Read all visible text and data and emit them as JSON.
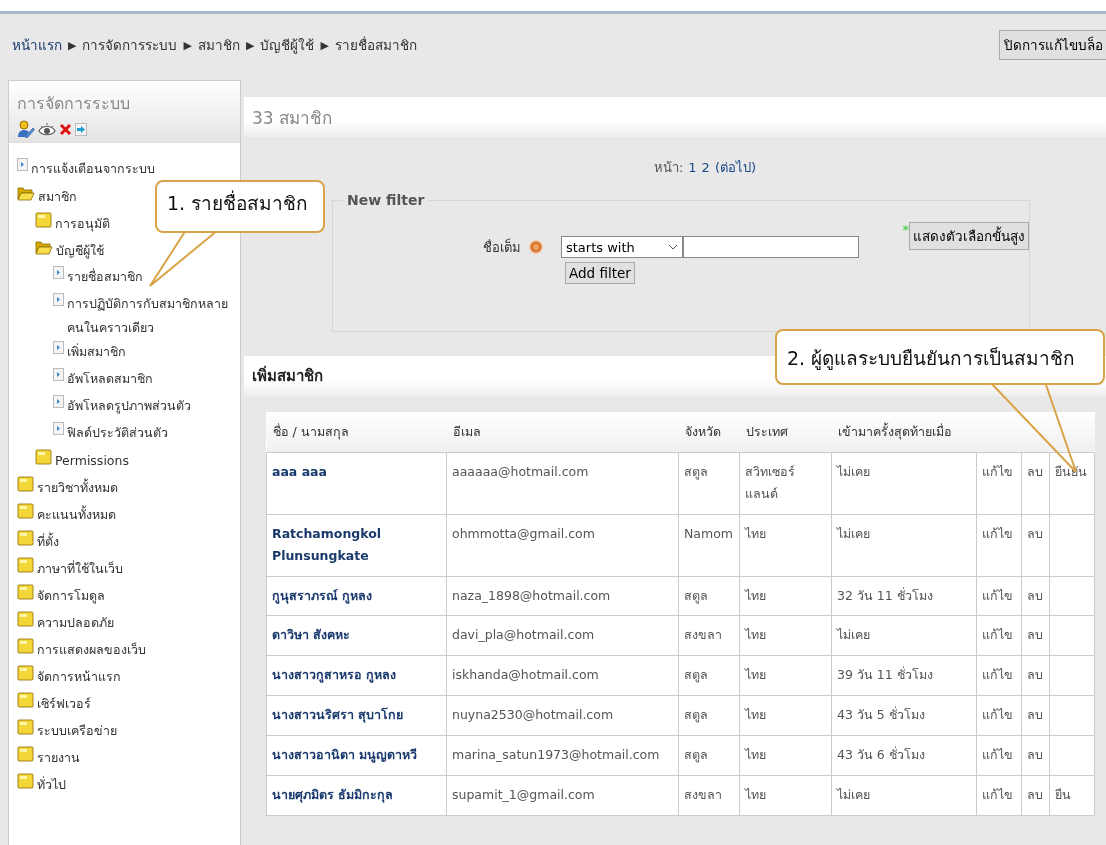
{
  "breadcrumb": [
    "หน้าแรก",
    "การจัดการระบบ",
    "สมาชิก",
    "บัญชีผู้ใช้",
    "รายชื่อสมาชิก"
  ],
  "breadcrumb_separator": "▶",
  "block_edit_button": "ปิดการแก้ไขบล็อ",
  "sidebar": {
    "title": "การจัดการระบบ",
    "items": [
      {
        "label": "การแจ้งเตือนจากระบบ",
        "kind": "page"
      },
      {
        "label": "สมาชิก",
        "kind": "folder",
        "expanded": true,
        "children": [
          {
            "label": "การอนุมัติ",
            "kind": "folder",
            "expanded": false
          },
          {
            "label": "บัญชีผู้ใช้",
            "kind": "folder",
            "expanded": true,
            "children": [
              {
                "label": "รายชื่อสมาชิก",
                "kind": "page"
              },
              {
                "label": "การปฏิบัติการกับสมาชิกหลายคนในคราวเดียว",
                "kind": "page"
              },
              {
                "label": "เพิ่มสมาชิก",
                "kind": "page"
              },
              {
                "label": "อัพโหลดสมาชิก",
                "kind": "page"
              },
              {
                "label": "อัพโหลดรูปภาพส่วนตัว",
                "kind": "page"
              },
              {
                "label": "ฟิลด์ประวัติส่วนตัว",
                "kind": "page"
              }
            ]
          },
          {
            "label": "Permissions",
            "kind": "folder",
            "expanded": false
          }
        ]
      },
      {
        "label": "รายวิชาทั้งหมด",
        "kind": "folder",
        "expanded": false
      },
      {
        "label": "คะแนนทั้งหมด",
        "kind": "folder",
        "expanded": false
      },
      {
        "label": "ที่ตั้ง",
        "kind": "folder",
        "expanded": false
      },
      {
        "label": "ภาษาที่ใช้ในเว็บ",
        "kind": "folder",
        "expanded": false
      },
      {
        "label": "จัดการโมดูล",
        "kind": "folder",
        "expanded": false
      },
      {
        "label": "ความปลอดภัย",
        "kind": "folder",
        "expanded": false
      },
      {
        "label": "การแสดงผลของเว็บ",
        "kind": "folder",
        "expanded": false
      },
      {
        "label": "จัดการหน้าแรก",
        "kind": "folder",
        "expanded": false
      },
      {
        "label": "เซิร์ฟเวอร์",
        "kind": "folder",
        "expanded": false
      },
      {
        "label": "ระบบเครือข่าย",
        "kind": "folder",
        "expanded": false
      },
      {
        "label": "รายงาน",
        "kind": "folder",
        "expanded": false
      },
      {
        "label": "ทั่วไป",
        "kind": "folder",
        "expanded": false
      }
    ]
  },
  "member_count": "33 สมาชิก",
  "pager": {
    "label": "หน้า:",
    "pages": [
      "1",
      "2"
    ],
    "next": "(ต่อไป)"
  },
  "filter": {
    "legend": "New filter",
    "advanced_mark": "*",
    "advanced_button": "แสดงตัวเลือกขั้นสูง",
    "field_label": "ชื่อเต็ม",
    "operator": "starts with",
    "add_button": "Add filter"
  },
  "add_member_heading": "เพิ่มสมาชิก",
  "table": {
    "columns": [
      "ชื่อ / นามสกุล",
      "อีเมล",
      "จังหวัด",
      "ประเทศ",
      "เข้ามาครั้งสุดท้ายเมื่อ"
    ],
    "rows": [
      {
        "name": "aaa aaa",
        "email": "aaaaaa@hotmail.com",
        "province": "สตูล",
        "country": "สวิทเซอร์แลนด์",
        "last_access": "ไม่เคย",
        "edit": "แก้ไข",
        "delete": "ลบ",
        "confirm": "ยืนยัน"
      },
      {
        "name": "Ratchamongkol Plunsungkate",
        "email": "ohmmotta@gmail.com",
        "province": "Namom",
        "country": "ไทย",
        "last_access": "ไม่เคย",
        "edit": "แก้ไข",
        "delete": "ลบ"
      },
      {
        "name": "กูนุสราภรณ์ กูหลง",
        "email": "naza_1898@hotmail.com",
        "province": "สตูล",
        "country": "ไทย",
        "last_access": "32 วัน 11 ชั่วโมง",
        "edit": "แก้ไข",
        "delete": "ลบ"
      },
      {
        "name": "ดาวิษา สังคหะ",
        "email": "davi_pla@hotmail.com",
        "province": "สงขลา",
        "country": "ไทย",
        "last_access": "ไม่เคย",
        "edit": "แก้ไข",
        "delete": "ลบ"
      },
      {
        "name": "นางสาวกูสาหรอ กูหลง",
        "email": "iskhanda@hotmail.com",
        "province": "สตูล",
        "country": "ไทย",
        "last_access": "39 วัน 11 ชั่วโมง",
        "edit": "แก้ไข",
        "delete": "ลบ"
      },
      {
        "name": "นางสาวนริศรา สุบาโกย",
        "email": "nuyna2530@hotmail.com",
        "province": "สตูล",
        "country": "ไทย",
        "last_access": "43 วัน 5 ชั่วโมง",
        "edit": "แก้ไข",
        "delete": "ลบ"
      },
      {
        "name": "นางสาวอานิตา มนูญดาหวี",
        "email": "marina_satun1973@hotmail.com",
        "province": "สตูล",
        "country": "ไทย",
        "last_access": "43 วัน 6 ชั่วโมง",
        "edit": "แก้ไข",
        "delete": "ลบ"
      },
      {
        "name": "นายศุภมิตร ธัมมิกะกุล",
        "email": "supamit_1@gmail.com",
        "province": "สงขลา",
        "country": "ไทย",
        "last_access": "ไม่เคย",
        "edit": "แก้ไข",
        "delete": "ลบ",
        "confirm": "ยืน"
      }
    ]
  },
  "callouts": [
    {
      "text": "1. รายชื่อสมาชิก"
    },
    {
      "text": "2. ผู้ดูแลระบบยืนยันการเป็นสมาชิก"
    }
  ]
}
